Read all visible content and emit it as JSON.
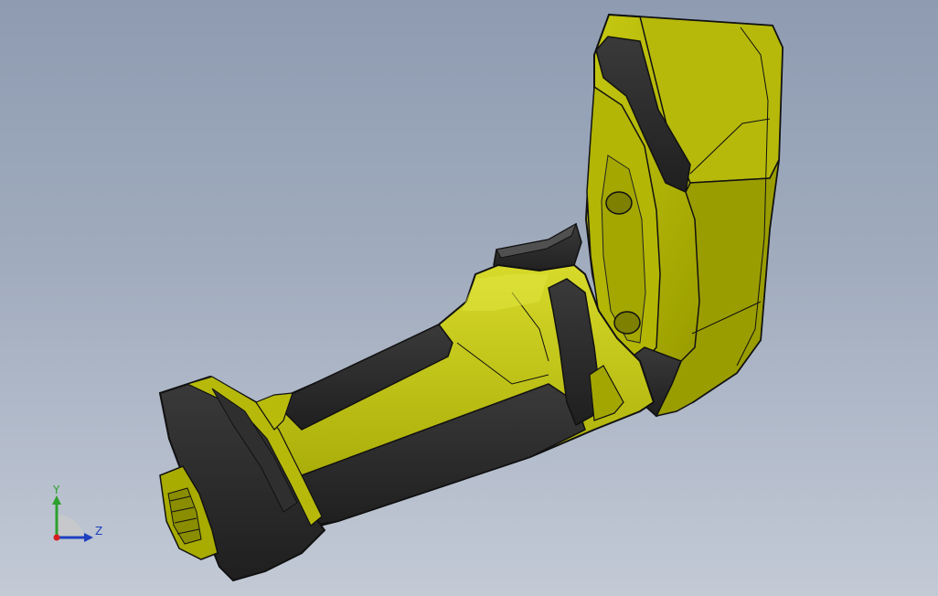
{
  "viewport": {
    "background_top": "#8e9bb1",
    "background_bottom": "#c3cad6"
  },
  "model": {
    "body_color": "#a7aa00",
    "highlight_color": "#d8dc35",
    "overmold_color": "#2b2b2b",
    "edge_color": "#111111"
  },
  "triad": {
    "y_label": "Y",
    "z_label": "Z",
    "y_color": "#2ca02c",
    "z_color": "#1f3fbf",
    "origin_color": "#d62020"
  }
}
